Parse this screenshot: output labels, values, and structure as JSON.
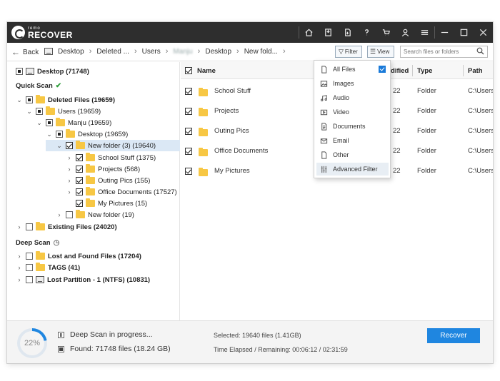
{
  "app": {
    "logo_small": "remo",
    "logo_big": "RECOVER"
  },
  "nav": {
    "back_label": "Back",
    "breadcrumbs": [
      "Desktop",
      "Deleted ...",
      "Users",
      "Manju",
      "Desktop",
      "New fold..."
    ],
    "filter_label": "Filter",
    "view_label": "View",
    "search_placeholder": "Search files or folders"
  },
  "tree": {
    "root": "Desktop (71748)",
    "quick_scan_label": "Quick Scan",
    "deep_scan_label": "Deep Scan",
    "quick_items": [
      {
        "label": "Deleted Files (19659)",
        "bold": true
      },
      {
        "label": "Users (19659)"
      },
      {
        "label": "Manju (19659)"
      },
      {
        "label": "Desktop (19659)"
      },
      {
        "label": "New folder (3) (19640)"
      },
      {
        "label": "School Stuff (1375)"
      },
      {
        "label": "Projects (568)"
      },
      {
        "label": "Outing Pics (155)"
      },
      {
        "label": "Office Documents (17527)"
      },
      {
        "label": "My Pictures (15)"
      },
      {
        "label": "New folder (19)"
      },
      {
        "label": "Existing Files (24020)",
        "bold": true
      }
    ],
    "deep_items": [
      {
        "label": "Lost and Found Files (17204)"
      },
      {
        "label": "TAGS (41)"
      },
      {
        "label": "Lost Partition - 1 (NTFS) (10831)"
      }
    ]
  },
  "list": {
    "columns": {
      "name": "Name",
      "modified": "dified",
      "type": "Type",
      "path": "Path"
    },
    "rows": [
      {
        "name": "School Stuff",
        "modified": "22",
        "type": "Folder",
        "path": "C:\\Users"
      },
      {
        "name": "Projects",
        "modified": "22",
        "type": "Folder",
        "path": "C:\\Users"
      },
      {
        "name": "Outing Pics",
        "modified": "22",
        "type": "Folder",
        "path": "C:\\Users"
      },
      {
        "name": "Office Documents",
        "modified": "22",
        "type": "Folder",
        "path": "C:\\Users"
      },
      {
        "name": "My Pictures",
        "modified": "22",
        "type": "Folder",
        "path": "C:\\Users"
      }
    ]
  },
  "filter_menu": {
    "items": [
      {
        "label": "All Files",
        "icon": "file-icon"
      },
      {
        "label": "Images",
        "icon": "image-icon"
      },
      {
        "label": "Audio",
        "icon": "music-icon"
      },
      {
        "label": "Video",
        "icon": "video-icon"
      },
      {
        "label": "Documents",
        "icon": "document-icon"
      },
      {
        "label": "Email",
        "icon": "email-icon"
      },
      {
        "label": "Other",
        "icon": "other-file-icon"
      },
      {
        "label": "Advanced Filter",
        "icon": "sliders-icon"
      }
    ]
  },
  "status": {
    "progress_text": "22%",
    "progress_fraction": 0.22,
    "scan_status": "Deep Scan in progress...",
    "found": "Found: 71748 files (18.24 GB)",
    "selected": "Selected: 19640 files (1.41GB)",
    "time": "Time Elapsed / Remaining: 00:06:12 / 02:31:59",
    "recover_label": "Recover"
  },
  "colors": {
    "titlebar": "#2e2e2e",
    "accent": "#1f86e0",
    "folder": "#f7c744",
    "check_green": "#2e9e3a"
  }
}
